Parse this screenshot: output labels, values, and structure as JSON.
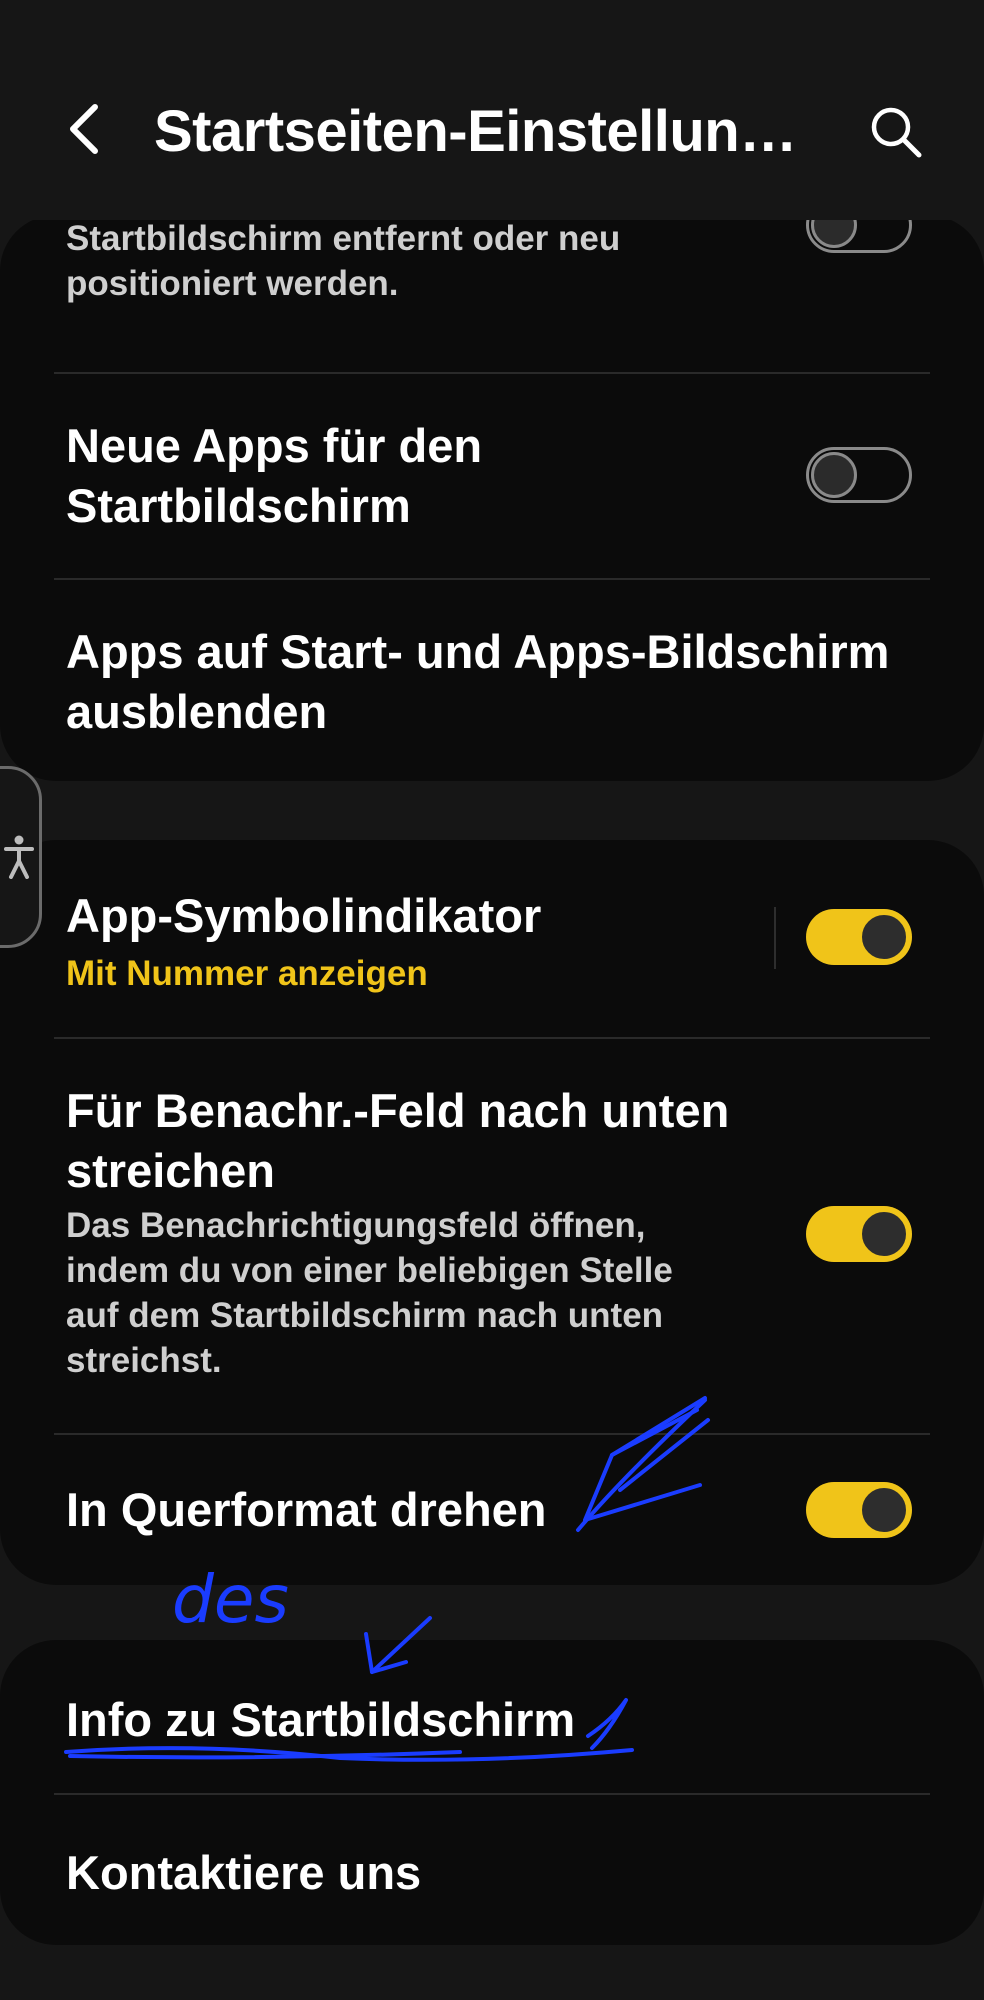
{
  "header": {
    "title": "Startseiten-Einstellun…",
    "back_icon": "chevron-left-icon",
    "search_icon": "search-icon"
  },
  "card1": {
    "layout_lock_desc": "verhindert, dass Elemente auf dem Startbildschirm entfernt oder neu positioniert werden.",
    "new_apps_title": "Neue Apps für den Startbildschirm",
    "new_apps_enabled": false,
    "hide_apps_title": "Apps auf Start- und Apps-Bildschirm ausblenden"
  },
  "card2": {
    "badge_title": "App-Symbolindikator",
    "badge_subtitle": "Mit Nummer anzeigen",
    "badge_enabled": true,
    "swipe_title": "Für Benachr.-Feld nach unten streichen",
    "swipe_desc": "Das Benachrichtigungsfeld öffnen, indem du von einer beliebigen Stelle auf dem Startbildschirm nach unten streichst.",
    "swipe_enabled": true,
    "rotate_title": "In Querformat drehen",
    "rotate_enabled": true
  },
  "card3": {
    "about_title": "Info zu Startbildschirm",
    "contact_title": "Kontaktiere uns"
  },
  "annotation": {
    "handwritten_text": "des",
    "ink_color": "#1a3cff"
  },
  "colors": {
    "accent": "#f0c419",
    "background": "#161616",
    "card": "#0b0b0b"
  },
  "accessibility_icon": "accessibility-icon"
}
